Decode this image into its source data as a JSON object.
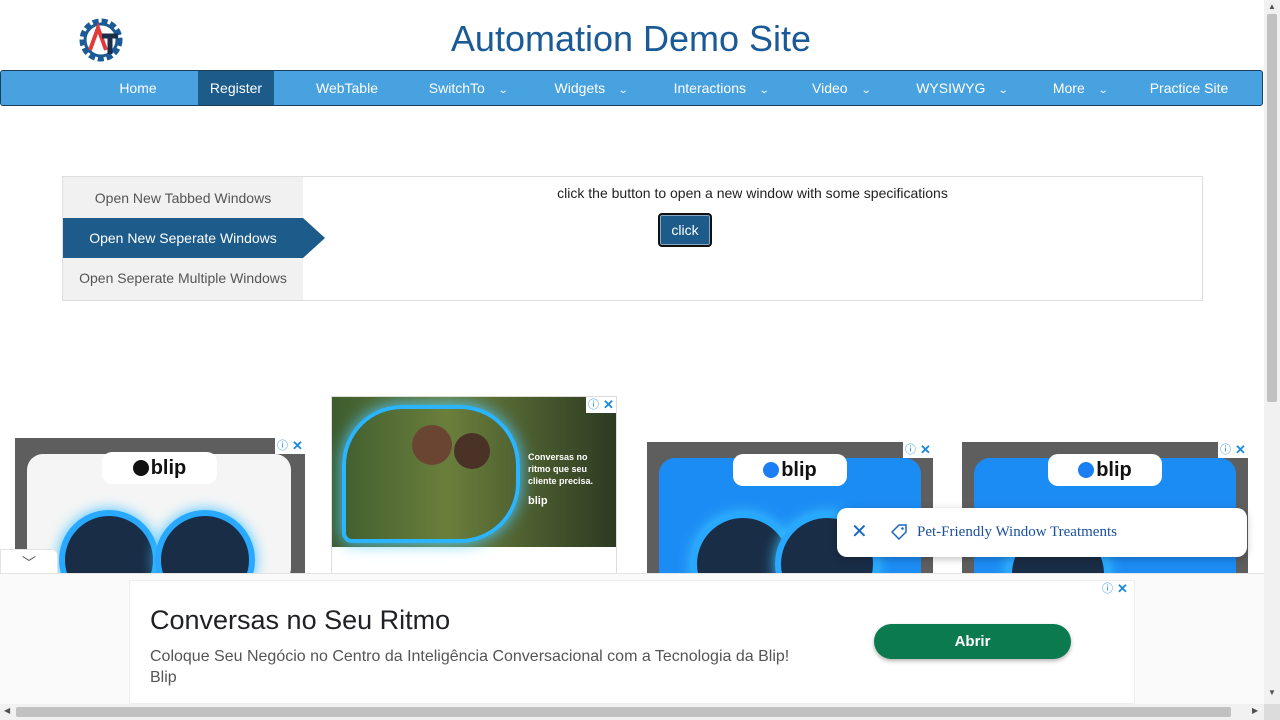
{
  "header": {
    "title": "Automation Demo Site",
    "logo_icon": "gear-logo-icon"
  },
  "nav": {
    "items": [
      {
        "label": "Home",
        "dropdown": false,
        "active": false
      },
      {
        "label": "Register",
        "dropdown": false,
        "active": true
      },
      {
        "label": "WebTable",
        "dropdown": false,
        "active": false
      },
      {
        "label": "SwitchTo",
        "dropdown": true,
        "active": false
      },
      {
        "label": "Widgets",
        "dropdown": true,
        "active": false
      },
      {
        "label": "Interactions",
        "dropdown": true,
        "active": false
      },
      {
        "label": "Video",
        "dropdown": true,
        "active": false
      },
      {
        "label": "WYSIWYG",
        "dropdown": true,
        "active": false
      },
      {
        "label": "More",
        "dropdown": true,
        "active": false
      },
      {
        "label": "Practice Site",
        "dropdown": false,
        "active": false
      }
    ],
    "chevron": "⌄"
  },
  "tabs": {
    "items": [
      {
        "label": "Open New Tabbed Windows",
        "active": false
      },
      {
        "label": "Open New Seperate Windows",
        "active": true
      },
      {
        "label": "Open Seperate Multiple Windows",
        "active": false
      }
    ],
    "panel_text": "click the button to open a new window with some specifications",
    "button_label": "click"
  },
  "ads": {
    "info_glyph": "ⓘ",
    "close_glyph": "✕",
    "brand": "blip",
    "middle_ad_text": "Conversas no ritmo que seu cliente precisa.",
    "popup": {
      "text": "Pet-Friendly Window Treatments",
      "close_glyph": "✕"
    },
    "bottom": {
      "headline": "Conversas no Seu Ritmo",
      "description": "Coloque Seu Negócio no Centro da Inteligência Conversacional com a Tecnologia da Blip!",
      "advertiser": "Blip",
      "cta": "Abrir",
      "collapse_glyph": "﹀"
    }
  },
  "colors": {
    "title": "#1a5a96",
    "nav_bg": "#48a2e0",
    "nav_active": "#1c5b8a",
    "cta_green": "#0b7a4f",
    "ad_blue": "#1b7ef2"
  }
}
